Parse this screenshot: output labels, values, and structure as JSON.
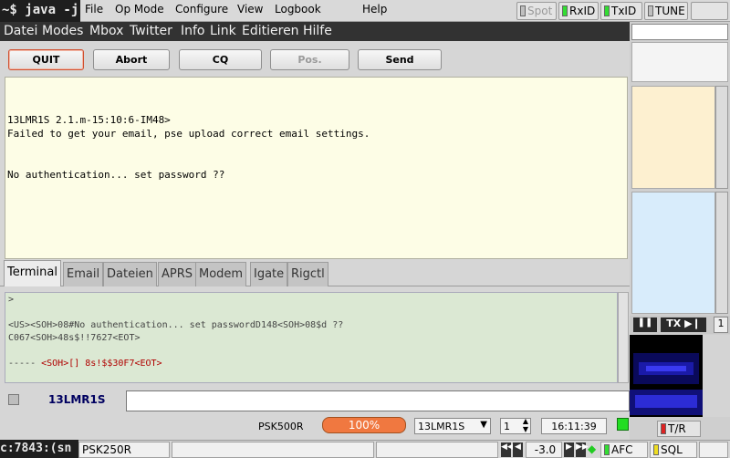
{
  "terminal": {
    "prompt_top": "~$ java -j",
    "prompt_bottom": "c:7843:(sn"
  },
  "fldigi": {
    "menus": [
      "File",
      "Op Mode",
      "Configure",
      "View",
      "Logbook",
      "Help"
    ],
    "buttons": {
      "spot": "Spot",
      "rxid": "RxID",
      "txid": "TxID",
      "tune": "TUNE"
    },
    "tx_button": "TX",
    "page_num": "1",
    "tr_label": "T/R",
    "status": {
      "mode": "PSK250R",
      "value": "-3.0",
      "afc": "AFC",
      "sql": "SQL"
    }
  },
  "app": {
    "menus": [
      "Datei",
      "Modes",
      "Mbox",
      "Twitter",
      "Info",
      "Link",
      "Editieren",
      "Hilfe"
    ],
    "buttons": {
      "quit": "QUIT",
      "abort": "Abort",
      "cq": "CQ",
      "pos": "Pos.",
      "send": "Send"
    },
    "rx_lines": [
      "13LMR1S 2.1.m-15:10:6-IM48>",
      "Failed to get your email, pse upload correct email settings.",
      "",
      "",
      "No authentication... set password ??"
    ],
    "tabs": [
      "Terminal",
      "Email",
      "Dateien",
      "APRS",
      "Modem",
      "Igate",
      "Rigctl"
    ],
    "term_lines": [
      ">",
      "",
      "<US><SOH>08#No authentication... set passwordD148<SOH>08$d ??",
      "C067<SOH>48s$!!7627<EOT>",
      "",
      "----- ",
      "<SOH>[] 8s!$$30F7<EOT>"
    ],
    "callsign": "13LMR1S",
    "mode": "PSK500R",
    "progress": "100%",
    "progress_value": 100,
    "select_call": "13LMR1S",
    "spin_value": "1",
    "time": "16:11:39"
  }
}
